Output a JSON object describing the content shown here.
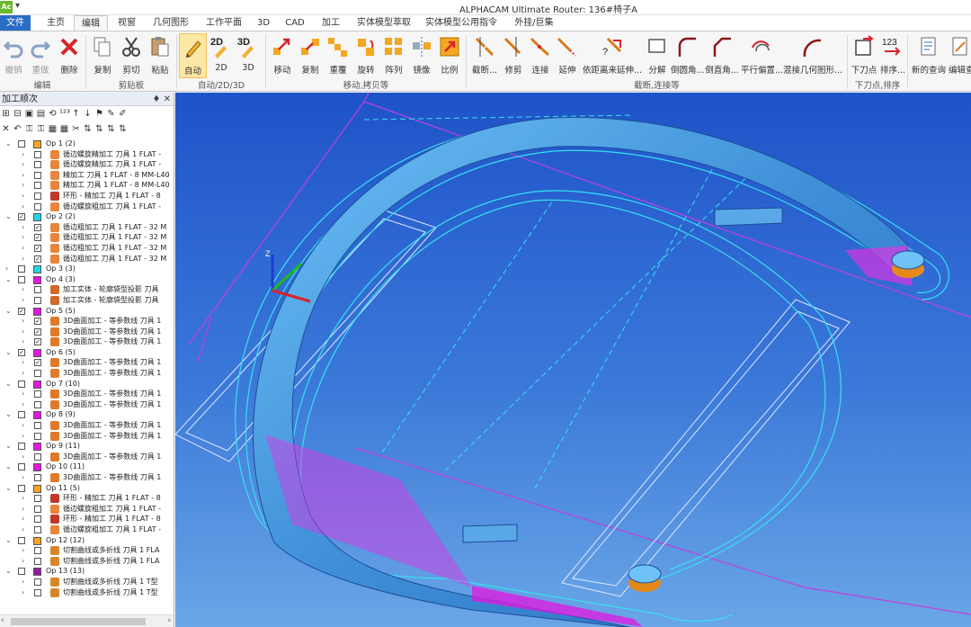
{
  "titlebar": {
    "app_icon": "Ac",
    "quick_access": "▾",
    "title": "ALPHACAM Ultimate Router: 136#椅子A"
  },
  "menu": [
    "文件",
    "主页",
    "编辑",
    "视窗",
    "几何图形",
    "工作平面",
    "3D",
    "CAD",
    "加工",
    "实体模型萃取",
    "实体模型公用指令",
    "外挂/巨集"
  ],
  "menu_active": "编辑",
  "ribbon": {
    "buttons": [
      {
        "label": "撤销",
        "icon": "undo-icon",
        "dim": true
      },
      {
        "label": "重做",
        "icon": "redo-icon",
        "dim": true
      },
      {
        "label": "删除",
        "icon": "delete-icon"
      },
      {
        "label": "复制",
        "icon": "copy-icon"
      },
      {
        "label": "剪切",
        "icon": "cut-icon"
      },
      {
        "label": "粘贴",
        "icon": "paste-icon"
      },
      {
        "label": "自动",
        "icon": "auto-icon",
        "selected": true
      },
      {
        "label": "2D",
        "icon": "2d-icon"
      },
      {
        "label": "3D",
        "icon": "3d-icon"
      },
      {
        "label": "移动",
        "icon": "move-icon"
      },
      {
        "label": "复制",
        "icon": "copy-transform-icon"
      },
      {
        "label": "重覆",
        "icon": "repeat-icon"
      },
      {
        "label": "旋转",
        "icon": "rotate-icon"
      },
      {
        "label": "阵列",
        "icon": "array-icon"
      },
      {
        "label": "镜像",
        "icon": "mirror-icon"
      },
      {
        "label": "比例",
        "icon": "scale-icon"
      },
      {
        "label": "截断...",
        "icon": "break-icon"
      },
      {
        "label": "修剪",
        "icon": "trim-icon"
      },
      {
        "label": "连接",
        "icon": "join-icon"
      },
      {
        "label": "延伸",
        "icon": "extend-icon"
      },
      {
        "label": "依距离来延伸...",
        "icon": "extend-distance-icon"
      },
      {
        "label": "分解",
        "icon": "explode-icon"
      },
      {
        "label": "倒圆角...",
        "icon": "fillet-icon"
      },
      {
        "label": "倒直角...",
        "icon": "chamfer-icon"
      },
      {
        "label": "平行偏置...",
        "icon": "offset-icon"
      },
      {
        "label": "混接几何图形...",
        "icon": "blend-icon"
      },
      {
        "label": "下刀点",
        "icon": "start-point-icon"
      },
      {
        "label": "排序...",
        "icon": "sort-icon"
      },
      {
        "label": "新的查询",
        "icon": "new-query-icon"
      },
      {
        "label": "编辑查",
        "icon": "edit-query-icon"
      }
    ],
    "groups": [
      "编辑",
      "剪贴板",
      "自动/2D/3D",
      "移动,拷贝等",
      "截断,连接等",
      "下刀点,排序"
    ]
  },
  "panel": {
    "title": "加工顺次",
    "pin": "♦ ✕",
    "toolbar_row1": [
      "⊞",
      "⊟",
      "▣",
      "▤",
      "⟲",
      "¹²³",
      "↑",
      "↓",
      "⚑",
      "✎",
      "✐"
    ],
    "toolbar_row2": [
      "✕",
      "↶",
      "⚿",
      "⚿",
      "▦",
      "▦",
      "✂",
      "⇅",
      "⇅",
      "⇅",
      "⇅"
    ]
  },
  "colors": {
    "accent": "#2b6cc4",
    "op_orange": "#f5a623",
    "op_cyan": "#1fd7e6",
    "op_magenta": "#e316e0",
    "op_purple": "#8e1b9e",
    "viewport_top": "#1f53c9",
    "viewport_bottom": "#6aa6e6",
    "toolpath_cyan": "#38e0f0",
    "toolpath_magenta": "#e62fe6",
    "part_blue": "#4a9fe4"
  },
  "tree": [
    {
      "level": 0,
      "label": "Op 1  (2)",
      "color": "#f5a623",
      "checked": false
    },
    {
      "level": 1,
      "label": "循边螺旋精加工   刀具 1  FLAT -",
      "icon": "toolpath-icon",
      "checked": false
    },
    {
      "level": 1,
      "label": "循边螺旋精加工   刀具 1  FLAT -",
      "icon": "toolpath-icon",
      "checked": false
    },
    {
      "level": 1,
      "label": "精加工   刀具 1  FLAT - 8 MM-L40",
      "icon": "toolpath-icon",
      "checked": false
    },
    {
      "level": 1,
      "label": "精加工   刀具 1  FLAT - 8 MM-L40",
      "icon": "toolpath-icon",
      "checked": false
    },
    {
      "level": 1,
      "label": "环形 - 精加工   刀具 1  FLAT - 8",
      "icon": "ring-icon",
      "checked": false
    },
    {
      "level": 1,
      "label": "循边螺旋粗加工   刀具 1  FLAT -",
      "icon": "toolpath-icon",
      "checked": false
    },
    {
      "level": 0,
      "label": "Op 2  (2)",
      "color": "#1fd7e6",
      "checked": true
    },
    {
      "level": 1,
      "label": "循边粗加工   刀具 1  FLAT - 32 M",
      "icon": "toolpath-icon",
      "checked": true
    },
    {
      "level": 1,
      "label": "循边粗加工   刀具 1  FLAT - 32 M",
      "icon": "toolpath-icon",
      "checked": true
    },
    {
      "level": 1,
      "label": "循边粗加工   刀具 1  FLAT - 32 M",
      "icon": "toolpath-icon",
      "checked": true
    },
    {
      "level": 1,
      "label": "循边粗加工   刀具 1  FLAT - 32 M",
      "icon": "toolpath-icon",
      "checked": true
    },
    {
      "level": 0,
      "label": "Op 3  (3)",
      "color": "#1fd7e6",
      "checked": false,
      "collapsed": true
    },
    {
      "level": 0,
      "label": "Op 4  (3)",
      "color": "#e316e0",
      "checked": false
    },
    {
      "level": 1,
      "label": "加工实体 - 轮廓袋型投影   刀具",
      "icon": "solid-icon",
      "checked": false
    },
    {
      "level": 1,
      "label": "加工实体 - 轮廓袋型投影   刀具",
      "icon": "solid-icon",
      "checked": false
    },
    {
      "level": 0,
      "label": "Op 5  (5)",
      "color": "#e316e0",
      "checked": true
    },
    {
      "level": 1,
      "label": "3D曲面加工 - 等参数线   刀具 1",
      "icon": "surface-icon",
      "checked": true
    },
    {
      "level": 1,
      "label": "3D曲面加工 - 等参数线   刀具 1",
      "icon": "surface-icon",
      "checked": true
    },
    {
      "level": 1,
      "label": "3D曲面加工 - 等参数线   刀具 1",
      "icon": "surface-icon",
      "checked": true
    },
    {
      "level": 0,
      "label": "Op 6  (5)",
      "color": "#e316e0",
      "checked": true
    },
    {
      "level": 1,
      "label": "3D曲面加工 - 等参数线   刀具 1",
      "icon": "surface-icon",
      "checked": true
    },
    {
      "level": 1,
      "label": "3D曲面加工 - 等参数线   刀具 1",
      "icon": "surface-icon",
      "checked": false
    },
    {
      "level": 0,
      "label": "Op 7  (10)",
      "color": "#e316e0",
      "checked": false
    },
    {
      "level": 1,
      "label": "3D曲面加工 - 等参数线   刀具 1",
      "icon": "surface-icon",
      "checked": false
    },
    {
      "level": 1,
      "label": "3D曲面加工 - 等参数线   刀具 1",
      "icon": "surface-icon",
      "checked": false
    },
    {
      "level": 0,
      "label": "Op 8  (9)",
      "color": "#e316e0",
      "checked": false
    },
    {
      "level": 1,
      "label": "3D曲面加工 - 等参数线   刀具 1",
      "icon": "surface-icon",
      "checked": false
    },
    {
      "level": 1,
      "label": "3D曲面加工 - 等参数线   刀具 1",
      "icon": "surface-icon",
      "checked": false
    },
    {
      "level": 0,
      "label": "Op 9  (11)",
      "color": "#e316e0",
      "checked": false
    },
    {
      "level": 1,
      "label": "3D曲面加工 - 等参数线   刀具 1",
      "icon": "surface-icon",
      "checked": false
    },
    {
      "level": 0,
      "label": "Op 10  (11)",
      "color": "#e316e0",
      "checked": false
    },
    {
      "level": 1,
      "label": "3D曲面加工 - 等参数线   刀具 1",
      "icon": "surface-icon",
      "checked": false
    },
    {
      "level": 0,
      "label": "Op 11  (5)",
      "color": "#f5a623",
      "checked": false
    },
    {
      "level": 1,
      "label": "环形 - 精加工   刀具 1  FLAT - 8",
      "icon": "ring-icon",
      "checked": false
    },
    {
      "level": 1,
      "label": "循边螺旋粗加工   刀具 1  FLAT -",
      "icon": "toolpath-icon",
      "checked": false
    },
    {
      "level": 1,
      "label": "环形 - 精加工   刀具 1  FLAT - 8",
      "icon": "ring-icon",
      "checked": false
    },
    {
      "level": 1,
      "label": "循边螺旋粗加工   刀具 1  FLAT -",
      "icon": "toolpath-icon",
      "checked": false
    },
    {
      "level": 0,
      "label": "Op 12  (12)",
      "color": "#f5a623",
      "checked": false
    },
    {
      "level": 1,
      "label": "切割曲线或多折线   刀具 1  FLA",
      "icon": "cut-curve-icon",
      "checked": false
    },
    {
      "level": 1,
      "label": "切割曲线或多折线   刀具 1  FLA",
      "icon": "cut-curve-icon",
      "checked": false
    },
    {
      "level": 0,
      "label": "Op 13  (13)",
      "color": "#8e1b9e",
      "checked": false
    },
    {
      "level": 1,
      "label": "切割曲线或多折线   刀具 1  T型",
      "icon": "cut-curve-icon",
      "checked": false
    },
    {
      "level": 1,
      "label": "切割曲线或多折线   刀具 1  T型",
      "icon": "cut-curve-icon",
      "checked": false
    }
  ]
}
